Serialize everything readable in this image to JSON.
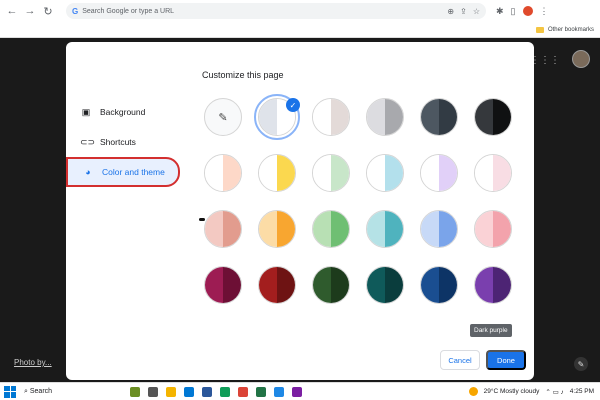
{
  "browser": {
    "omnibox_placeholder": "Search Google or type a URL",
    "bookmarks_label": "Other bookmarks"
  },
  "ntp": {
    "photo_credit": "Photo by..."
  },
  "dialog": {
    "title": "Customize this page",
    "sidebar": [
      {
        "label": "Background",
        "icon": "image-icon"
      },
      {
        "label": "Shortcuts",
        "icon": "link-icon"
      },
      {
        "label": "Color and theme",
        "icon": "palette-icon",
        "active": true
      }
    ],
    "swatches": [
      {
        "name": "custom-color",
        "left": "#f8f9fa",
        "right": "#f8f9fa",
        "picker": true
      },
      {
        "name": "default",
        "left": "#dfe3ea",
        "right": "#ffffff",
        "selected": true
      },
      {
        "name": "warm-grey",
        "left": "#ffffff",
        "right": "#e3dad8"
      },
      {
        "name": "cool-grey",
        "left": "#dcdce0",
        "right": "#a8a9ad"
      },
      {
        "name": "dark-slate",
        "left": "#4d5761",
        "right": "#323b44"
      },
      {
        "name": "black",
        "left": "#35383c",
        "right": "#101112"
      },
      {
        "name": "beige-peach",
        "left": "#ffffff",
        "right": "#fdd8c8"
      },
      {
        "name": "yellow",
        "left": "#ffffff",
        "right": "#fbd84f"
      },
      {
        "name": "green-light",
        "left": "#ffffff",
        "right": "#c8e6c9"
      },
      {
        "name": "light-teal",
        "left": "#ffffff",
        "right": "#b3e0ec"
      },
      {
        "name": "light-purple",
        "left": "#ffffff",
        "right": "#e1d0f8"
      },
      {
        "name": "light-pink",
        "left": "#ffffff",
        "right": "#f8dde4"
      },
      {
        "name": "salmon",
        "left": "#f3c9c2",
        "right": "#e29c8e"
      },
      {
        "name": "orange",
        "left": "#fcdca6",
        "right": "#f8a630"
      },
      {
        "name": "green",
        "left": "#b8e0b4",
        "right": "#6fbf73"
      },
      {
        "name": "teal",
        "left": "#b5e2e6",
        "right": "#4fb3be"
      },
      {
        "name": "blue",
        "left": "#c7d9f7",
        "right": "#7aa4ea"
      },
      {
        "name": "pink",
        "left": "#fad2d6",
        "right": "#f3a3ac"
      },
      {
        "name": "dark-pink",
        "left": "#9d1c53",
        "right": "#6d0f35"
      },
      {
        "name": "dark-red",
        "left": "#a31e1e",
        "right": "#6e1313"
      },
      {
        "name": "dark-green",
        "left": "#2f5b2d",
        "right": "#1d3b1c"
      },
      {
        "name": "dark-teal",
        "left": "#0f5a5a",
        "right": "#0a3d3d"
      },
      {
        "name": "dark-blue",
        "left": "#1a4e91",
        "right": "#0d3466"
      },
      {
        "name": "dark-purple",
        "left": "#7a3fae",
        "right": "#4d2474"
      }
    ],
    "tooltip": "Dark purple",
    "cancel_label": "Cancel",
    "done_label": "Done"
  },
  "taskbar": {
    "search_label": "Search",
    "weather": "29°C  Mostly cloudy",
    "time": "4:25 PM"
  }
}
